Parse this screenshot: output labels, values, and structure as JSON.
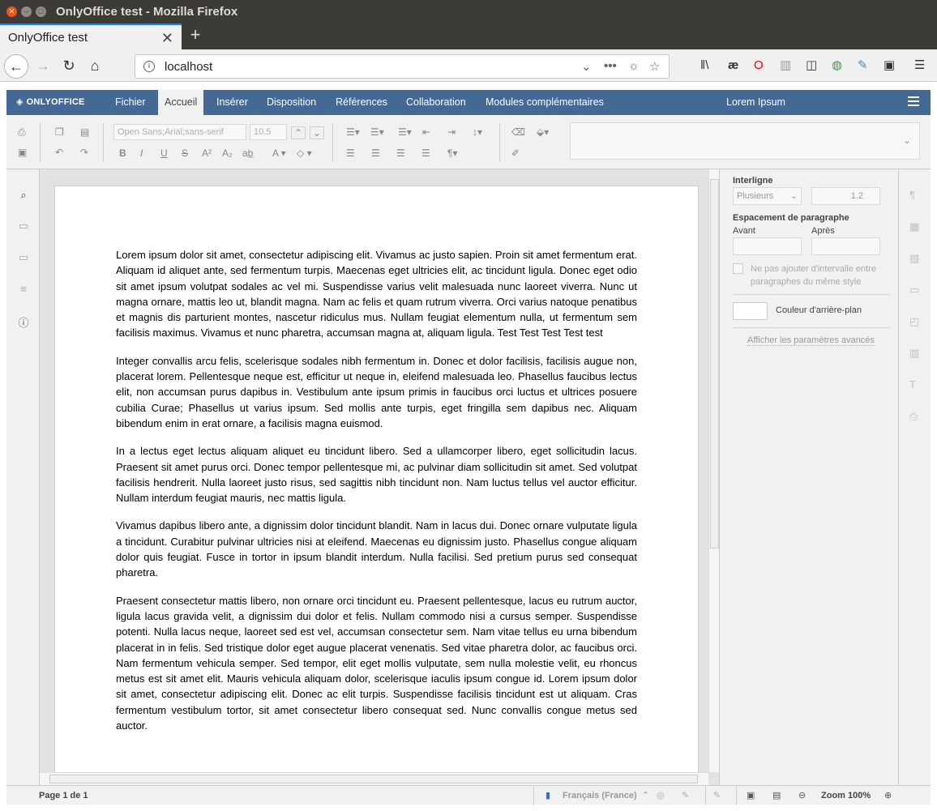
{
  "window": {
    "title": "OnlyOffice test - Mozilla Firefox"
  },
  "browser": {
    "tab_title": "OnlyOffice test",
    "url": "localhost"
  },
  "app": {
    "logo": "ONLYOFFICE",
    "menu_tabs": [
      "Fichier",
      "Accueil",
      "Insérer",
      "Disposition",
      "Références",
      "Collaboration",
      "Modules complémentaires"
    ],
    "active_tab": "Accueil",
    "doc_title": "Lorem Ipsum"
  },
  "toolbar": {
    "font_name": "Open Sans;Arial;sans-serif",
    "font_size": "10.5"
  },
  "document": {
    "paragraphs": [
      "Lorem ipsum dolor sit amet, consectetur adipiscing elit. Vivamus ac justo sapien. Proin sit amet fermentum erat. Aliquam id aliquet ante, sed fermentum turpis. Maecenas eget ultricies elit, ac tincidunt ligula. Donec eget odio sit amet ipsum volutpat sodales ac vel mi. Suspendisse varius velit malesuada nunc laoreet viverra. Nunc ut magna ornare, mattis leo ut, blandit magna. Nam ac felis et quam rutrum viverra. Orci varius natoque penatibus et magnis dis parturient montes, nascetur ridiculus mus. Nullam feugiat elementum nulla, ut fermentum sem facilisis maximus. Vivamus et nunc pharetra, accumsan magna at, aliquam ligula. Test Test Test  Test test",
      "Integer convallis arcu felis, scelerisque sodales nibh fermentum in. Donec et dolor facilisis, facilisis augue non, placerat lorem. Pellentesque neque est, efficitur ut neque in, eleifend malesuada leo. Phasellus faucibus lectus elit, non accumsan purus dapibus in. Vestibulum ante ipsum primis in faucibus orci luctus et ultrices posuere cubilia Curae; Phasellus ut varius ipsum. Sed mollis ante turpis, eget fringilla sem dapibus nec. Aliquam bibendum enim in erat ornare, a facilisis magna euismod.",
      "In a lectus eget lectus aliquam aliquet eu tincidunt libero. Sed a ullamcorper libero, eget sollicitudin lacus. Praesent sit amet purus orci. Donec tempor pellentesque mi, ac pulvinar diam sollicitudin sit amet. Sed volutpat facilisis hendrerit. Nulla laoreet justo risus, sed sagittis nibh tincidunt non. Nam luctus tellus vel auctor efficitur. Nullam interdum feugiat mauris, nec mattis ligula.",
      "Vivamus dapibus libero ante, a dignissim dolor tincidunt blandit. Nam in lacus dui. Donec ornare vulputate ligula a tincidunt. Curabitur pulvinar ultricies nisi at eleifend. Maecenas eu dignissim justo. Phasellus congue aliquam dolor quis feugiat. Fusce in tortor in ipsum blandit interdum. Nulla facilisi. Sed pretium purus sed consequat pharetra.",
      "Praesent consectetur mattis libero, non ornare orci tincidunt eu. Praesent pellentesque, lacus eu rutrum auctor, ligula lacus gravida velit, a dignissim dui dolor et felis. Nullam commodo nisi a cursus semper. Suspendisse potenti. Nulla lacus neque, laoreet sed est vel, accumsan consectetur sem. Nam vitae tellus eu urna bibendum placerat in in felis. Sed tristique dolor eget augue placerat venenatis. Sed vitae pharetra dolor, ac faucibus orci. Nam fermentum vehicula semper. Sed tempor, elit eget mollis vulputate, sem nulla molestie velit, eu rhoncus metus est sit amet elit. Mauris vehicula aliquam dolor, scelerisque iaculis ipsum congue id. Lorem ipsum dolor sit amet, consectetur adipiscing elit. Donec ac elit turpis. Suspendisse facilisis tincidunt est ut aliquam. Cras fermentum vestibulum tortor, sit amet consectetur libero consequat sed. Nunc convallis congue metus sed auctor."
    ]
  },
  "right_panel": {
    "line_spacing_label": "Interligne",
    "line_spacing_type": "Plusieurs",
    "line_spacing_value": "1.2",
    "para_spacing_label": "Espacement de paragraphe",
    "before_label": "Avant",
    "after_label": "Après",
    "no_interval_label": "Ne pas ajouter d'intervalle entre paragraphes du même style",
    "bg_color_label": "Couleur d'arrière-plan",
    "advanced_link": "Afficher les paramètres avancés"
  },
  "status_bar": {
    "page_info": "Page 1 de 1",
    "language": "Français (France)",
    "zoom": "Zoom 100%"
  },
  "colors": {
    "header_blue": "#446995",
    "accent": "#e95420"
  }
}
